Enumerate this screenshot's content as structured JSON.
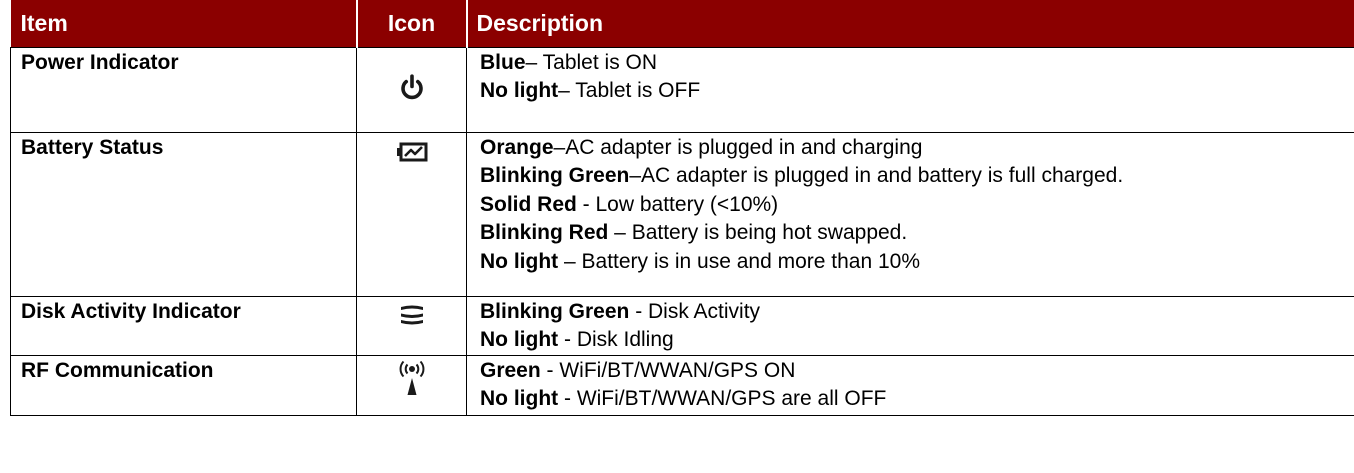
{
  "table": {
    "headers": {
      "item": "Item",
      "icon": "Icon",
      "description": "Description"
    },
    "rows": [
      {
        "item": "Power Indicator",
        "icon": "power-icon",
        "lines": [
          {
            "label": "Blue",
            "text": "– Tablet is ON"
          },
          {
            "label": "No light",
            "text": "– Tablet is OFF"
          }
        ]
      },
      {
        "item": "Battery Status",
        "icon": "battery-status-icon",
        "lines": [
          {
            "label": "Orange",
            "text": "–AC adapter is plugged in and charging"
          },
          {
            "label": "Blinking Green",
            "text": "–AC adapter is plugged in and battery is full charged."
          },
          {
            "label": "Solid Red",
            "text": " - Low battery (<10%)"
          },
          {
            "label": "Blinking Red",
            "text": " – Battery is being hot swapped."
          },
          {
            "label": "No light",
            "text": " – Battery is in use and more than 10%"
          }
        ]
      },
      {
        "item": "Disk Activity Indicator",
        "icon": "disk-activity-icon",
        "lines": [
          {
            "label": "Blinking Green",
            "text": " - Disk Activity"
          },
          {
            "label": "No light",
            "text": " - Disk Idling"
          }
        ]
      },
      {
        "item": "RF Communication",
        "icon": "rf-communication-icon",
        "lines": [
          {
            "label": "Green",
            "text": " - WiFi/BT/WWAN/GPS ON"
          },
          {
            "label": "No light",
            "text": " - WiFi/BT/WWAN/GPS are all OFF"
          }
        ]
      }
    ]
  },
  "colors": {
    "header_bg": "#8b0000",
    "header_text": "#ffffff",
    "icon": "#1a1a1a"
  }
}
